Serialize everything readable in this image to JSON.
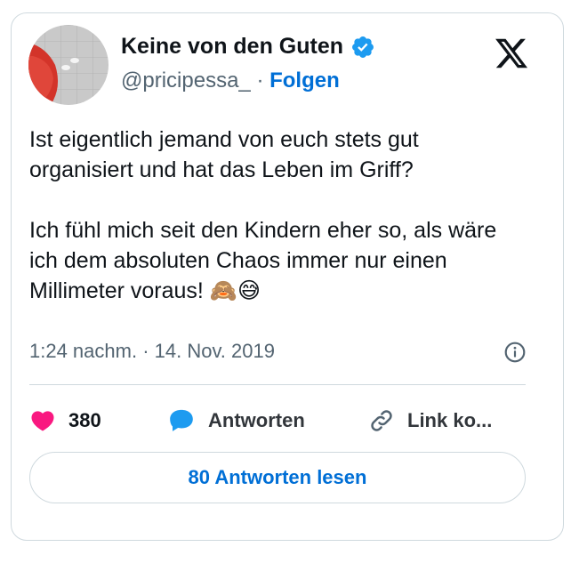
{
  "author": {
    "display_name": "Keine von den Guten",
    "handle": "@pricipessa_",
    "separator": "·",
    "follow_label": "Folgen"
  },
  "tweet": {
    "paragraph_1": "Ist eigentlich jemand von euch stets gut organisiert und hat das Leben im Griff?",
    "paragraph_2_text": "Ich fühl mich seit den Kindern eher so, als wäre ich dem absoluten Chaos immer nur einen Millimeter voraus!",
    "emoji_1": "🙈",
    "emoji_2": "😅",
    "timestamp": "1:24 nachm. · 14. Nov. 2019"
  },
  "actions": {
    "like_count": "380",
    "reply_label": "Antworten",
    "copy_link_label": "Link ko..."
  },
  "read_replies_label": "80 Antworten lesen",
  "colors": {
    "text": "#0f1419",
    "secondary": "#536471",
    "link": "#006fd6",
    "like": "#f91880",
    "reply_bubble": "#1d9bf0",
    "border": "#cfd9de"
  },
  "icons": {
    "verified": "verified-badge-icon",
    "logo": "x-logo-icon",
    "info": "info-icon",
    "like": "heart-icon",
    "reply": "speech-bubble-icon",
    "copy": "link-icon"
  }
}
